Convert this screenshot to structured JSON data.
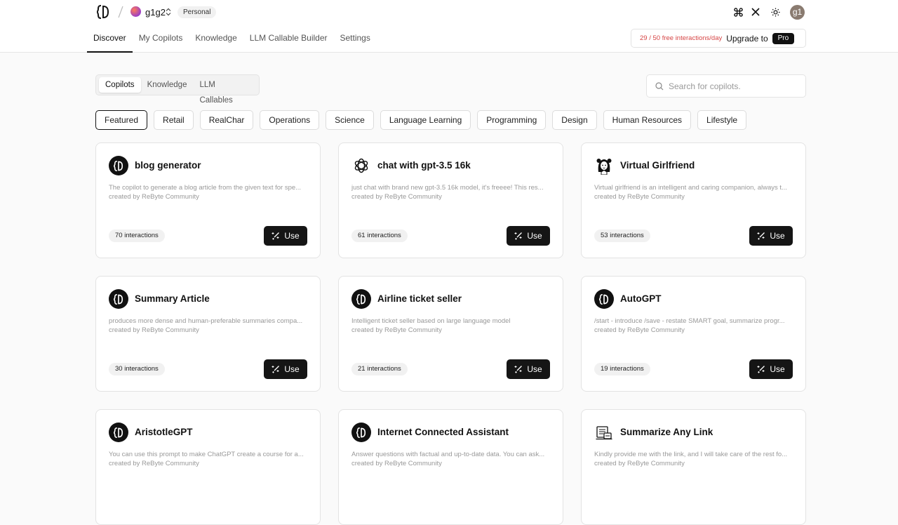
{
  "header": {
    "workspace_name": "g1g2",
    "workspace_badge": "Personal",
    "user_initials": "g1"
  },
  "nav": [
    {
      "label": "Discover",
      "active": true
    },
    {
      "label": "My Copilots",
      "active": false
    },
    {
      "label": "Knowledge",
      "active": false
    },
    {
      "label": "LLM Callable Builder",
      "active": false
    },
    {
      "label": "Settings",
      "active": false
    }
  ],
  "quota": {
    "text": "29 / 50 free interactions/day",
    "upgrade_label": "Upgrade to",
    "pro_label": "Pro"
  },
  "tabs": [
    {
      "label": "Copilots",
      "active": true
    },
    {
      "label": "Knowledge",
      "active": false
    },
    {
      "label": "LLM Callables",
      "active": false
    }
  ],
  "search": {
    "placeholder": "Search for copilots.",
    "value": ""
  },
  "categories": [
    {
      "label": "Featured",
      "active": true
    },
    {
      "label": "Retail",
      "active": false
    },
    {
      "label": "RealChar",
      "active": false
    },
    {
      "label": "Operations",
      "active": false
    },
    {
      "label": "Science",
      "active": false
    },
    {
      "label": "Language Learning",
      "active": false
    },
    {
      "label": "Programming",
      "active": false
    },
    {
      "label": "Design",
      "active": false
    },
    {
      "label": "Human Resources",
      "active": false
    },
    {
      "label": "Lifestyle",
      "active": false
    }
  ],
  "use_label": "Use",
  "cards": [
    {
      "title": "blog generator",
      "desc": "The copilot to generate a blog article from the given text for spe...",
      "author": "created by ReByte Community",
      "count": "70 interactions",
      "icon": "rebyte-logo-icon"
    },
    {
      "title": "chat with gpt-3.5 16k",
      "desc": "just chat with brand new gpt-3.5 16k model, it's freeee! This res...",
      "author": "created by ReByte Community",
      "count": "61 interactions",
      "icon": "openai-icon"
    },
    {
      "title": "Virtual Girlfriend",
      "desc": "Virtual girlfriend is an intelligent and caring companion, always t...",
      "author": "created by ReByte Community",
      "count": "53 interactions",
      "icon": "girl-avatar-icon"
    },
    {
      "title": "Summary Article",
      "desc": "produces more dense and human-preferable summaries compa...",
      "author": "created by ReByte Community",
      "count": "30 interactions",
      "icon": "rebyte-logo-icon"
    },
    {
      "title": "Airline ticket seller",
      "desc": "Intelligent ticket seller based on large language model",
      "author": "created by ReByte Community",
      "count": "21 interactions",
      "icon": "rebyte-logo-icon"
    },
    {
      "title": "AutoGPT",
      "desc": "/start - introduce /save - restate SMART goal, summarize progr...",
      "author": "created by ReByte Community",
      "count": "19 interactions",
      "icon": "rebyte-logo-icon"
    },
    {
      "title": "AristotleGPT",
      "desc": "You can use this prompt to make ChatGPT create a course for a...",
      "author": "created by ReByte Community",
      "count": "",
      "icon": "rebyte-logo-icon"
    },
    {
      "title": "Internet Connected Assistant",
      "desc": "Answer questions with factual and up-to-date data. You can ask...",
      "author": "created by ReByte Community",
      "count": "",
      "icon": "rebyte-logo-icon"
    },
    {
      "title": "Summarize Any Link",
      "desc": "Kindly provide me with the link, and I will take care of the rest fo...",
      "author": "created by ReByte Community",
      "count": "",
      "icon": "document-link-icon"
    }
  ]
}
